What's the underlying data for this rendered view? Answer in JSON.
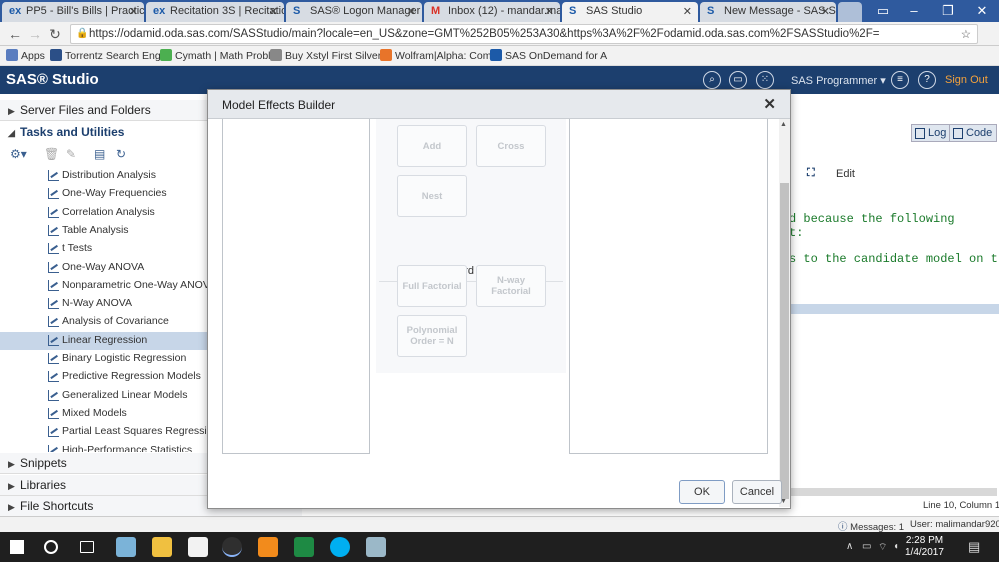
{
  "browser": {
    "tabs": [
      {
        "label": "PP5 - Bill's Bills | Practic",
        "favicon": "ex"
      },
      {
        "label": "Recitation 3S | Recitatio",
        "favicon": "ex"
      },
      {
        "label": "SAS® Logon Manager",
        "favicon": "S"
      },
      {
        "label": "Inbox (12) - mandar.ma",
        "favicon": "M"
      },
      {
        "label": "SAS Studio",
        "favicon": "S"
      },
      {
        "label": "New Message - SAS Su",
        "favicon": "S"
      }
    ],
    "url": "https://odamid.oda.sas.com/SASStudio/main?locale=en_US&zone=GMT%252B05%253A30&https%3A%2F%2Fodamid.oda.sas.com%2FSASStudio%2F=",
    "bookmarks": [
      {
        "label": "Apps",
        "color": "#5a7dbf"
      },
      {
        "label": "Torrentz Search Engin",
        "color": "#2b4f87"
      },
      {
        "label": "Cymath | Math Proble",
        "color": "#4caf50"
      },
      {
        "label": "Buy Xstyl First Silver F",
        "color": "#888888"
      },
      {
        "label": "Wolfram|Alpha: Comp",
        "color": "#e8742a"
      },
      {
        "label": "SAS OnDemand for A",
        "color": "#1c5aa8"
      }
    ]
  },
  "sas": {
    "brand": "SAS® Studio",
    "user_role": "SAS Programmer ▾",
    "sign_out": "Sign Out"
  },
  "left": {
    "sections_top": [
      {
        "label": "Server Files and Folders",
        "expanded": false
      },
      {
        "label": "Tasks and Utilities",
        "expanded": true
      }
    ],
    "tasks": [
      "Distribution Analysis",
      "One-Way Frequencies",
      "Correlation Analysis",
      "Table Analysis",
      "t Tests",
      "One-Way ANOVA",
      "Nonparametric One-Way ANOVA",
      "N-Way ANOVA",
      "Analysis of Covariance",
      "Linear Regression",
      "Binary Logistic Regression",
      "Predictive Regression Models",
      "Generalized Linear Models",
      "Mixed Models",
      "Partial Least Squares Regression",
      "High-Performance Statistics"
    ],
    "selected_task": "Linear Regression",
    "sections_bottom": [
      "Snippets",
      "Libraries",
      "File Shortcuts"
    ]
  },
  "right": {
    "log_label": "Log",
    "code_label": "Code",
    "edit_label": "Edit",
    "log_lines": [
      "d because the following",
      "t:",
      "s to the candidate model on t"
    ],
    "line_col": "Line 10, Column 1"
  },
  "status": {
    "messages": "Messages: 1",
    "user": "User: malimandar920"
  },
  "taskbar": {
    "time": "2:28 PM",
    "date": "1/4/2017"
  },
  "modal": {
    "title": "Model Effects Builder",
    "add": "Add",
    "cross": "Cross",
    "nest": "Nest",
    "standard_models": "Standard Models",
    "full_factorial": "Full Factorial",
    "nway_factorial": "N-way Factorial",
    "polynomial": "Polynomial Order = N",
    "ok": "OK",
    "cancel": "Cancel"
  }
}
